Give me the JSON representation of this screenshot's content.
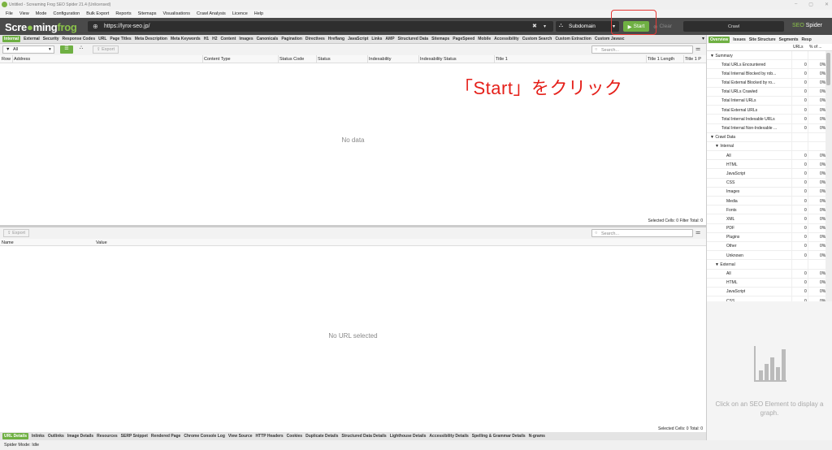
{
  "window": {
    "title": "Untitled - Screaming Frog SEO Spider 21.4 (Unlicensed)"
  },
  "menu": [
    "File",
    "View",
    "Mode",
    "Configuration",
    "Bulk Export",
    "Reports",
    "Sitemaps",
    "Visualisations",
    "Crawl Analysis",
    "Licence",
    "Help"
  ],
  "header": {
    "logo_a": "Scre",
    "logo_b": "ming",
    "logo_c": "frog",
    "url": "https://lynx-seo.jp/",
    "mode": "Subdomain",
    "start_label": "Start",
    "clear_label": "Clear",
    "crawl_label": "Crawl",
    "product_a": "SEO",
    "product_b": "Spider"
  },
  "tabs": [
    "Internal",
    "External",
    "Security",
    "Response Codes",
    "URL",
    "Page Titles",
    "Meta Description",
    "Meta Keywords",
    "H1",
    "H2",
    "Content",
    "Images",
    "Canonicals",
    "Pagination",
    "Directives",
    "Hreflang",
    "JavaScript",
    "Links",
    "AMP",
    "Structured Data",
    "Sitemaps",
    "PageSpeed",
    "Mobile",
    "Accessibility",
    "Custom Search",
    "Custom Extraction",
    "Custom Javasc"
  ],
  "toolbar": {
    "filter": "All",
    "export": "Export",
    "search_placeholder": "Search..."
  },
  "table": {
    "columns": [
      "Row",
      "Address",
      "Content Type",
      "Status Code",
      "Status",
      "Indexability",
      "Indexability Status",
      "Title 1",
      "Title 1 Length",
      "Title 1 P"
    ],
    "empty": "No data",
    "status": "Selected Cells: 0  Filter Total: 0"
  },
  "annotation": "「Start」をクリック",
  "lower": {
    "export": "Export",
    "search_placeholder": "Search...",
    "columns": [
      "Name",
      "Value"
    ],
    "empty": "No URL selected",
    "status": "Selected Cells: 0  Total: 0"
  },
  "bottom_tabs": [
    "URL Details",
    "Inlinks",
    "Outlinks",
    "Image Details",
    "Resources",
    "SERP Snippet",
    "Rendered Page",
    "Chrome Console Log",
    "View Source",
    "HTTP Headers",
    "Cookies",
    "Duplicate Details",
    "Structured Data Details",
    "Lighthouse Details",
    "Accessibility Details",
    "Spelling & Grammar Details",
    "N-grams"
  ],
  "spider_status": "Spider Mode: Idle",
  "right_panel": {
    "tabs": [
      "Overview",
      "Issues",
      "Site Structure",
      "Segments",
      "Resp"
    ],
    "col_urls": "URLs",
    "col_pct": "% of ...",
    "rows": [
      {
        "label": "▼ Summary",
        "indent": 0,
        "n": "",
        "p": ""
      },
      {
        "label": "Total URLs Encountered",
        "indent": 2,
        "n": "0",
        "p": "0%"
      },
      {
        "label": "Total Internal Blocked by rob...",
        "indent": 2,
        "n": "0",
        "p": "0%"
      },
      {
        "label": "Total External Blocked by ro...",
        "indent": 2,
        "n": "0",
        "p": "0%"
      },
      {
        "label": "Total URLs Crawled",
        "indent": 2,
        "n": "0",
        "p": "0%"
      },
      {
        "label": "Total Internal URLs",
        "indent": 2,
        "n": "0",
        "p": "0%"
      },
      {
        "label": "Total External URLs",
        "indent": 2,
        "n": "0",
        "p": "0%"
      },
      {
        "label": "Total Internal Indexable URLs",
        "indent": 2,
        "n": "0",
        "p": "0%"
      },
      {
        "label": "Total Internal Non-Indexable ...",
        "indent": 2,
        "n": "0",
        "p": "0%"
      },
      {
        "label": "▼ Crawl Data",
        "indent": 0,
        "n": "",
        "p": ""
      },
      {
        "label": "▼ Internal",
        "indent": 1,
        "n": "",
        "p": ""
      },
      {
        "label": "All",
        "indent": 3,
        "n": "0",
        "p": "0%"
      },
      {
        "label": "HTML",
        "indent": 3,
        "n": "0",
        "p": "0%"
      },
      {
        "label": "JavaScript",
        "indent": 3,
        "n": "0",
        "p": "0%"
      },
      {
        "label": "CSS",
        "indent": 3,
        "n": "0",
        "p": "0%"
      },
      {
        "label": "Images",
        "indent": 3,
        "n": "0",
        "p": "0%"
      },
      {
        "label": "Media",
        "indent": 3,
        "n": "0",
        "p": "0%"
      },
      {
        "label": "Fonts",
        "indent": 3,
        "n": "0",
        "p": "0%"
      },
      {
        "label": "XML",
        "indent": 3,
        "n": "0",
        "p": "0%"
      },
      {
        "label": "PDF",
        "indent": 3,
        "n": "0",
        "p": "0%"
      },
      {
        "label": "Plugins",
        "indent": 3,
        "n": "0",
        "p": "0%"
      },
      {
        "label": "Other",
        "indent": 3,
        "n": "0",
        "p": "0%"
      },
      {
        "label": "Unknown",
        "indent": 3,
        "n": "0",
        "p": "0%"
      },
      {
        "label": "▼ External",
        "indent": 1,
        "n": "",
        "p": ""
      },
      {
        "label": "All",
        "indent": 3,
        "n": "0",
        "p": "0%"
      },
      {
        "label": "HTML",
        "indent": 3,
        "n": "0",
        "p": "0%"
      },
      {
        "label": "JavaScript",
        "indent": 3,
        "n": "0",
        "p": "0%"
      },
      {
        "label": "CSS",
        "indent": 3,
        "n": "0",
        "p": "0%"
      }
    ],
    "chart_msg": "Click on an SEO Element to display a graph."
  },
  "colors": {
    "accent": "#6fb043",
    "header": "#4a4a4a",
    "annotation": "#e5201a"
  }
}
